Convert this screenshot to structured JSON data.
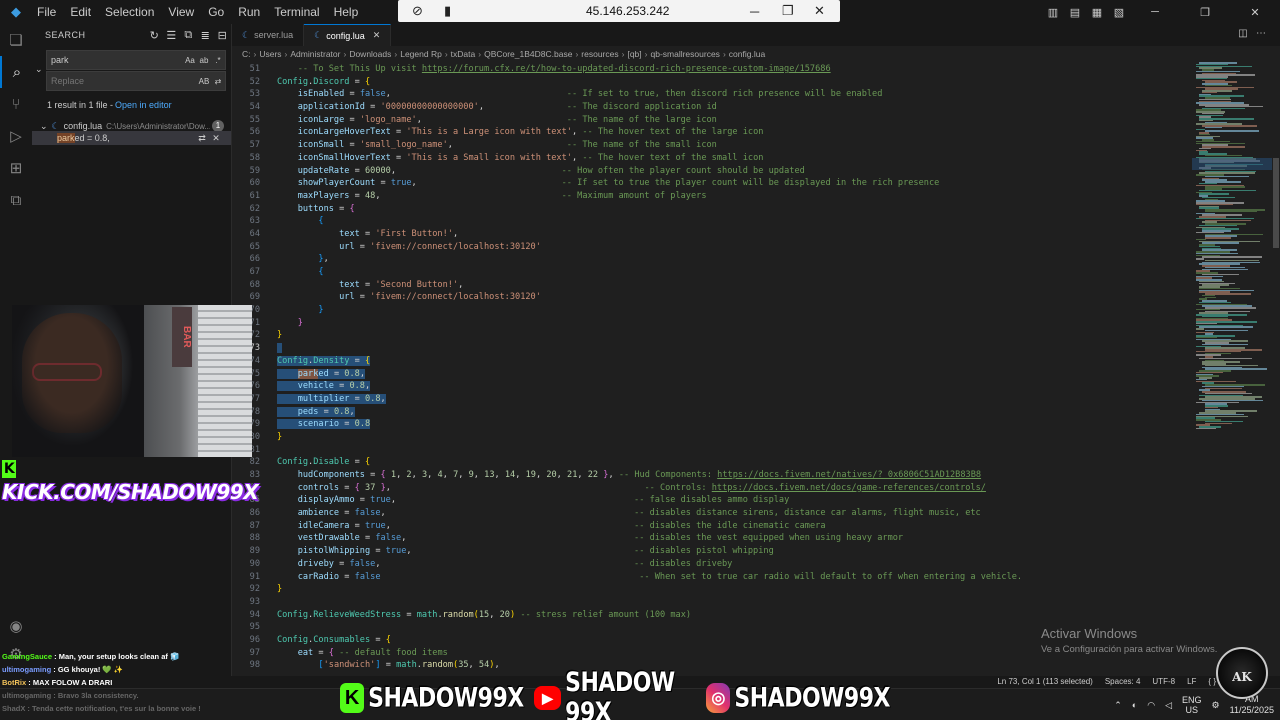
{
  "titlebar": {
    "menu": [
      "File",
      "Edit",
      "Selection",
      "View",
      "Go",
      "Run",
      "Terminal",
      "Help"
    ],
    "remote_ip": "45.146.253.242"
  },
  "sidebar": {
    "title": "SEARCH",
    "search_value": "park",
    "replace_placeholder": "Replace",
    "result_summary": "1 result in 1 file -",
    "open_in_editor": "Open in editor",
    "file_name": "config.lua",
    "file_path": "C:\\Users\\Administrator\\Dow...",
    "match_count": "1",
    "match_prefix": "",
    "match_hit": "park",
    "match_suffix": "ed = 0.8,"
  },
  "tabs": [
    {
      "label": "server.lua",
      "active": false
    },
    {
      "label": "config.lua",
      "active": true
    }
  ],
  "breadcrumb": [
    "C:",
    "Users",
    "Administrator",
    "Downloads",
    "Legend Rp",
    "txData",
    "QBCore_1B4D8C.base",
    "resources",
    "[qb]",
    "qb-smallresources",
    "config.lua"
  ],
  "code_lines": [
    {
      "n": 51,
      "html": "    <span class=\"c\">-- To Set This Up visit </span><span class=\"u\">https://forum.cfx.re/t/how-to-updated-discord-rich-presence-custom-image/157686</span>"
    },
    {
      "n": 52,
      "html": "<span class=\"g\">Config</span><span class=\"t\">.</span><span class=\"g\">Discord</span><span class=\"t\"> = </span><span class=\"b1\">{</span>"
    },
    {
      "n": 53,
      "html": "    <span class=\"k\">isEnabled</span><span class=\"t\"> = </span><span class=\"kw\">false</span><span class=\"t\">,</span>                                  <span class=\"c\">-- If set to true, then discord rich presence will be enabled</span>"
    },
    {
      "n": 54,
      "html": "    <span class=\"k\">applicationId</span><span class=\"t\"> = </span><span class=\"v\">'00000000000000000'</span><span class=\"t\">,</span>                <span class=\"c\">-- The discord application id</span>"
    },
    {
      "n": 55,
      "html": "    <span class=\"k\">iconLarge</span><span class=\"t\"> = </span><span class=\"v\">'logo_name'</span><span class=\"t\">,</span>                            <span class=\"c\">-- The name of the large icon</span>"
    },
    {
      "n": 56,
      "html": "    <span class=\"k\">iconLargeHoverText</span><span class=\"t\"> = </span><span class=\"v\">'This is a Large icon with text'</span><span class=\"t\">,</span> <span class=\"c\">-- The hover text of the large icon</span>"
    },
    {
      "n": 57,
      "html": "    <span class=\"k\">iconSmall</span><span class=\"t\"> = </span><span class=\"v\">'small_logo_name'</span><span class=\"t\">,</span>                      <span class=\"c\">-- The name of the small icon</span>"
    },
    {
      "n": 58,
      "html": "    <span class=\"k\">iconSmallHoverText</span><span class=\"t\"> = </span><span class=\"v\">'This is a Small icon with text'</span><span class=\"t\">,</span> <span class=\"c\">-- The hover text of the small icon</span>"
    },
    {
      "n": 59,
      "html": "    <span class=\"k\">updateRate</span><span class=\"t\"> = </span><span class=\"n\">60000</span><span class=\"t\">,</span>                                <span class=\"c\">-- How often the player count should be updated</span>"
    },
    {
      "n": 60,
      "html": "    <span class=\"k\">showPlayerCount</span><span class=\"t\"> = </span><span class=\"kw\">true</span><span class=\"t\">,</span>                            <span class=\"c\">-- If set to true the player count will be displayed in the rich presence</span>"
    },
    {
      "n": 61,
      "html": "    <span class=\"k\">maxPlayers</span><span class=\"t\"> = </span><span class=\"n\">48</span><span class=\"t\">,</span>                                   <span class=\"c\">-- Maximum amount of players</span>"
    },
    {
      "n": 62,
      "html": "    <span class=\"k\">buttons</span><span class=\"t\"> = </span><span class=\"b2\">{</span>"
    },
    {
      "n": 63,
      "html": "        <span class=\"b3\">{</span>"
    },
    {
      "n": 64,
      "html": "            <span class=\"k\">text</span><span class=\"t\"> = </span><span class=\"v\">'First Button!'</span><span class=\"t\">,</span>"
    },
    {
      "n": 65,
      "html": "            <span class=\"k\">url</span><span class=\"t\"> = </span><span class=\"v\">'fivem://connect/localhost:30120'</span>"
    },
    {
      "n": 66,
      "html": "        <span class=\"b3\">}</span><span class=\"t\">,</span>"
    },
    {
      "n": 67,
      "html": "        <span class=\"b3\">{</span>"
    },
    {
      "n": 68,
      "html": "            <span class=\"k\">text</span><span class=\"t\"> = </span><span class=\"v\">'Second Button!'</span><span class=\"t\">,</span>"
    },
    {
      "n": 69,
      "html": "            <span class=\"k\">url</span><span class=\"t\"> = </span><span class=\"v\">'fivem://connect/localhost:30120'</span>"
    },
    {
      "n": 70,
      "html": "        <span class=\"b3\">}</span>"
    },
    {
      "n": 71,
      "html": "    <span class=\"b2\">}</span>"
    },
    {
      "n": 72,
      "html": "<span class=\"b1\">}</span>"
    },
    {
      "n": 73,
      "html": "<span class=\"sel\"> </span>",
      "cur": true
    },
    {
      "n": 74,
      "html": "<span class=\"sel\"><span class=\"g\">Config</span><span class=\"t\">.</span><span class=\"g\">Density</span><span class=\"t\"> = </span><span class=\"b1\">{</span></span>"
    },
    {
      "n": 75,
      "html": "<span class=\"sel\">    <span class=\"find\"><span class=\"k\">park</span></span><span class=\"k\">ed</span><span class=\"t\"> = </span><span class=\"n\">0.8</span><span class=\"t\">,</span></span>"
    },
    {
      "n": 76,
      "html": "<span class=\"sel\">    <span class=\"k\">vehicle</span><span class=\"t\"> = </span><span class=\"n\">0.8</span><span class=\"t\">,</span></span>"
    },
    {
      "n": 77,
      "html": "<span class=\"sel\">    <span class=\"k\">multiplier</span><span class=\"t\"> = </span><span class=\"n\">0.8</span><span class=\"t\">,</span></span>"
    },
    {
      "n": 78,
      "html": "<span class=\"sel\">    <span class=\"k\">peds</span><span class=\"t\"> = </span><span class=\"n\">0.8</span><span class=\"t\">,</span></span>"
    },
    {
      "n": 79,
      "html": "<span class=\"sel\">    <span class=\"k\">scenario</span><span class=\"t\"> = </span><span class=\"n\">0.8</span></span>"
    },
    {
      "n": 80,
      "html": "<span class=\"b1\">}</span>"
    },
    {
      "n": 81,
      "html": ""
    },
    {
      "n": 82,
      "html": "<span class=\"g\">Config</span><span class=\"t\">.</span><span class=\"g\">Disable</span><span class=\"t\"> = </span><span class=\"b1\">{</span>"
    },
    {
      "n": 83,
      "html": "    <span class=\"k\">hudComponents</span><span class=\"t\"> = </span><span class=\"b2\">{</span><span class=\"t\"> </span><span class=\"n\">1</span><span class=\"t\">, </span><span class=\"n\">2</span><span class=\"t\">, </span><span class=\"n\">3</span><span class=\"t\">, </span><span class=\"n\">4</span><span class=\"t\">, </span><span class=\"n\">7</span><span class=\"t\">, </span><span class=\"n\">9</span><span class=\"t\">, </span><span class=\"n\">13</span><span class=\"t\">, </span><span class=\"n\">14</span><span class=\"t\">, </span><span class=\"n\">19</span><span class=\"t\">, </span><span class=\"n\">20</span><span class=\"t\">, </span><span class=\"n\">21</span><span class=\"t\">, </span><span class=\"n\">22</span><span class=\"t\"> </span><span class=\"b2\">}</span><span class=\"t\">,</span> <span class=\"c\">-- Hud Components: </span><span class=\"u\">https://docs.fivem.net/natives/?_0x6806C51AD12B83B8</span>"
    },
    {
      "n": 84,
      "html": "    <span class=\"k\">controls</span><span class=\"t\"> = </span><span class=\"b2\">{</span><span class=\"t\"> </span><span class=\"n\">37</span><span class=\"t\"> </span><span class=\"b2\">}</span><span class=\"t\">,</span>                                                 <span class=\"c\">-- Controls: </span><span class=\"u\">https://docs.fivem.net/docs/game-references/controls/</span>"
    },
    {
      "n": 85,
      "html": "    <span class=\"k\">displayAmmo</span><span class=\"t\"> = </span><span class=\"kw\">true</span><span class=\"t\">,</span>                                              <span class=\"c\">-- false disables ammo display</span>"
    },
    {
      "n": 86,
      "html": "    <span class=\"k\">ambience</span><span class=\"t\"> = </span><span class=\"kw\">false</span><span class=\"t\">,</span>                                                <span class=\"c\">-- disables distance sirens, distance car alarms, flight music, etc</span>"
    },
    {
      "n": 87,
      "html": "    <span class=\"k\">idleCamera</span><span class=\"t\"> = </span><span class=\"kw\">true</span><span class=\"t\">,</span>                                               <span class=\"c\">-- disables the idle cinematic camera</span>"
    },
    {
      "n": 88,
      "html": "    <span class=\"k\">vestDrawable</span><span class=\"t\"> = </span><span class=\"kw\">false</span><span class=\"t\">,</span>                                            <span class=\"c\">-- disables the vest equipped when using heavy armor</span>"
    },
    {
      "n": 89,
      "html": "    <span class=\"k\">pistolWhipping</span><span class=\"t\"> = </span><span class=\"kw\">true</span><span class=\"t\">,</span>                                           <span class=\"c\">-- disables pistol whipping</span>"
    },
    {
      "n": 90,
      "html": "    <span class=\"k\">driveby</span><span class=\"t\"> = </span><span class=\"kw\">false</span><span class=\"t\">,</span>                                                 <span class=\"c\">-- disables driveby</span>"
    },
    {
      "n": 91,
      "html": "    <span class=\"k\">carRadio</span><span class=\"t\"> = </span><span class=\"kw\">false</span>                                                  <span class=\"c\">-- When set to true car radio will default to off when entering a vehicle.</span>"
    },
    {
      "n": 92,
      "html": "<span class=\"b1\">}</span>"
    },
    {
      "n": 93,
      "html": ""
    },
    {
      "n": 94,
      "html": "<span class=\"g\">Config</span><span class=\"t\">.</span><span class=\"g\">RelieveWeedStress</span><span class=\"t\"> = </span><span class=\"g\">math</span><span class=\"t\">.</span><span class=\"f\">random</span><span class=\"b1\">(</span><span class=\"n\">15</span><span class=\"t\">, </span><span class=\"n\">20</span><span class=\"b1\">)</span><span class=\"t\"> </span><span class=\"c\">-- stress relief amount (100 max)</span>"
    },
    {
      "n": 95,
      "html": ""
    },
    {
      "n": 96,
      "html": "<span class=\"g\">Config</span><span class=\"t\">.</span><span class=\"g\">Consumables</span><span class=\"t\"> = </span><span class=\"b1\">{</span>"
    },
    {
      "n": 97,
      "html": "    <span class=\"k\">eat</span><span class=\"t\"> = </span><span class=\"b2\">{</span><span class=\"t\"> </span><span class=\"c\">-- default food items</span>"
    },
    {
      "n": 98,
      "html": "        <span class=\"b3\">[</span><span class=\"v\">'sandwich'</span><span class=\"b3\">]</span><span class=\"t\"> = </span><span class=\"g\">math</span><span class=\"t\">.</span><span class=\"f\">random</span><span class=\"b1\">(</span><span class=\"n\">35</span><span class=\"t\">, </span><span class=\"n\">54</span><span class=\"b1\">)</span><span class=\"t\">,</span>"
    }
  ],
  "statusbar": {
    "cursor": "Ln 73, Col 1 (113 selected)",
    "spaces": "Spaces: 4",
    "encoding": "UTF-8",
    "eol": "LF",
    "braces": "{ }"
  },
  "activate_windows": {
    "title": "Activar Windows",
    "subtitle": "Ve a Configuración para activar Windows."
  },
  "taskbar": {
    "lang_1": "ENG",
    "lang_2": "US",
    "time": "AM",
    "date": "11/25/2025"
  },
  "overlay": {
    "kick_url": "KICK.COM/SHADOW99X",
    "webcam_sign": "BAR",
    "chat": [
      {
        "user": "GamingSauce",
        "text": ": Man, your setup looks clean af 🧊",
        "faded": false
      },
      {
        "user": "ultimogaming",
        "text": ": GG khouya! 💚 ✨",
        "faded": false
      },
      {
        "user": "BotRix",
        "text": ": MAX FOLOW A DRARI",
        "faded": false
      },
      {
        "user": "ultimogaming",
        "text": ": Bravo 3la consistency.",
        "faded": true
      },
      {
        "user": "ShadX",
        "text": ": Tenda cette notification, t'es sur la bonne voie !",
        "faded": true
      }
    ],
    "socials": [
      {
        "icon": "kick-icon",
        "glyph": "K",
        "handle": "SHADOW99X"
      },
      {
        "icon": "youtube-icon",
        "glyph": "▶",
        "handle": "SHADOW 99X"
      },
      {
        "icon": "instagram-icon",
        "glyph": "◎",
        "handle": "SHADOW99X"
      }
    ],
    "logo": "AK"
  },
  "colors": {
    "accent": "#0078d4",
    "kick_green": "#53fc18",
    "selection": "#264f78"
  }
}
